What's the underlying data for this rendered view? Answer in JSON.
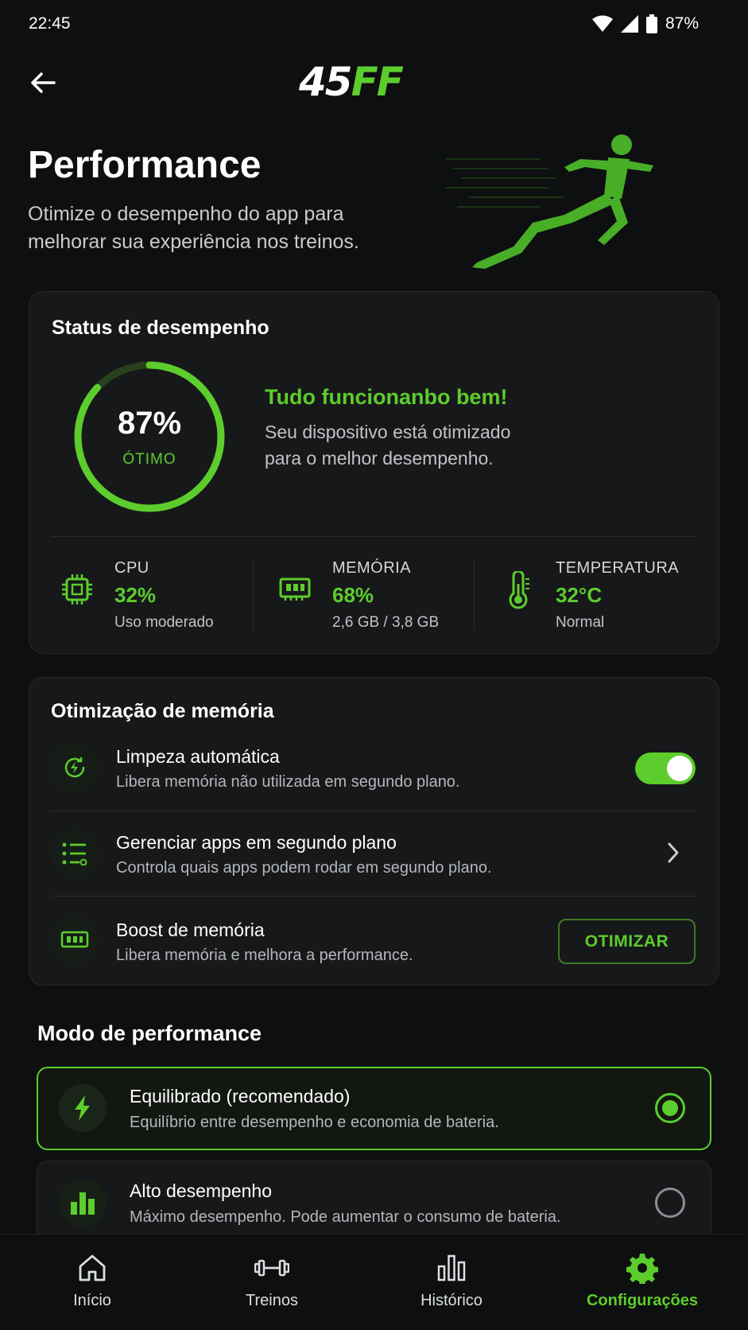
{
  "status_bar": {
    "time": "22:45",
    "battery": "87%"
  },
  "header": {
    "logo_main": "45",
    "logo_accent": "FF"
  },
  "page": {
    "title": "Performance",
    "subtitle_line1": "Otimize o desempenho do app para",
    "subtitle_line2": "melhorar sua experiência nos treinos."
  },
  "status_card": {
    "title": "Status de desempenho",
    "score_text": "87%",
    "score_value": 0.87,
    "score_label": "ÓTIMO",
    "headline": "Tudo funcionanbo bem!",
    "desc_line1": "Seu dispositivo está otimizado",
    "desc_line2": "para o melhor desempenho.",
    "metrics": [
      {
        "label": "CPU",
        "value": "32%",
        "sub": "Uso moderado",
        "icon": "cpu-chip-icon"
      },
      {
        "label": "MEMÓRIA",
        "value": "68%",
        "sub": "2,6 GB / 3,8 GB",
        "icon": "memory-ram-icon"
      },
      {
        "label": "TEMPERATURA",
        "value": "32°C",
        "sub": "Normal",
        "icon": "thermometer-icon"
      }
    ]
  },
  "memory_card": {
    "title": "Otimização de memória",
    "rows": [
      {
        "title": "Limpeza automática",
        "desc": "Libera memória não utilizada em segundo plano.",
        "toggle_on": true
      },
      {
        "title": "Gerenciar apps em segundo plano",
        "desc": "Controla quais apps podem rodar em segundo plano."
      },
      {
        "title": "Boost de memória",
        "desc": "Libera memória e melhora a performance.",
        "button": "OTIMIZAR"
      }
    ]
  },
  "modes": {
    "title": "Modo de performance",
    "items": [
      {
        "title": "Equilibrado (recomendado)",
        "desc": "Equilíbrio entre desempenho e economia de bateria.",
        "selected": true
      },
      {
        "title": "Alto desempenho",
        "desc": "Máximo desempenho. Pode aumentar o consumo de bateria.",
        "selected": false
      }
    ]
  },
  "nav": {
    "items": [
      {
        "label": "Início",
        "icon": "home-icon"
      },
      {
        "label": "Treinos",
        "icon": "dumbbell-icon"
      },
      {
        "label": "Histórico",
        "icon": "bar-chart-icon"
      },
      {
        "label": "Configurações",
        "icon": "gear-icon",
        "active": true
      }
    ]
  },
  "colors": {
    "accent": "#5ccd2c",
    "background": "#0e0f10",
    "card": "#17181a"
  }
}
